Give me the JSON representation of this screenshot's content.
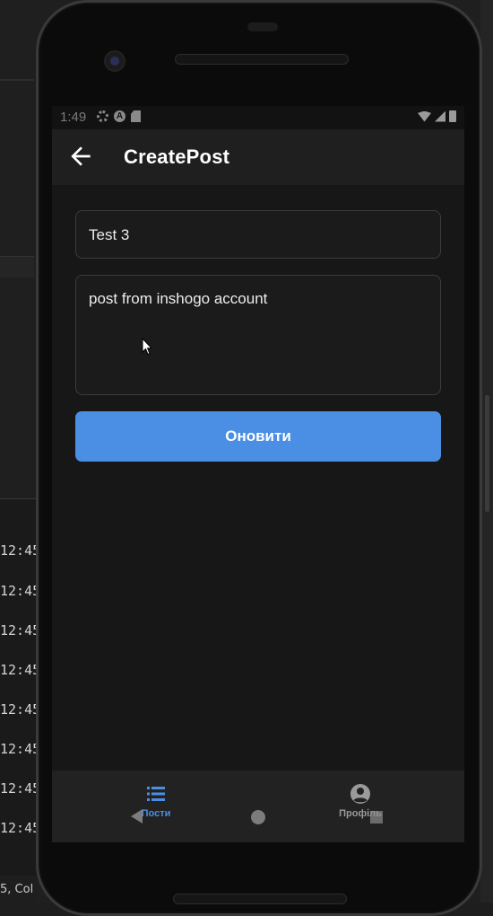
{
  "ide": {
    "log_times": [
      "12:45",
      "12:45",
      "12:45",
      "12:45",
      "12:45",
      "12:45",
      "12:45",
      "12:45"
    ],
    "status_text": "5, Col"
  },
  "statusbar": {
    "time": "1:49"
  },
  "appbar": {
    "title": "CreatePost",
    "back_icon": "arrow-left-icon"
  },
  "form": {
    "title_value": "Test 3",
    "body_value": "post from inshogo account",
    "submit_label": "Оновити",
    "accent_color": "#4a8fe3"
  },
  "bottom_nav": {
    "items": [
      {
        "label": "Пости",
        "icon": "list-icon",
        "active": true
      },
      {
        "label": "Профіль",
        "icon": "account-circle-icon",
        "active": false
      }
    ]
  }
}
